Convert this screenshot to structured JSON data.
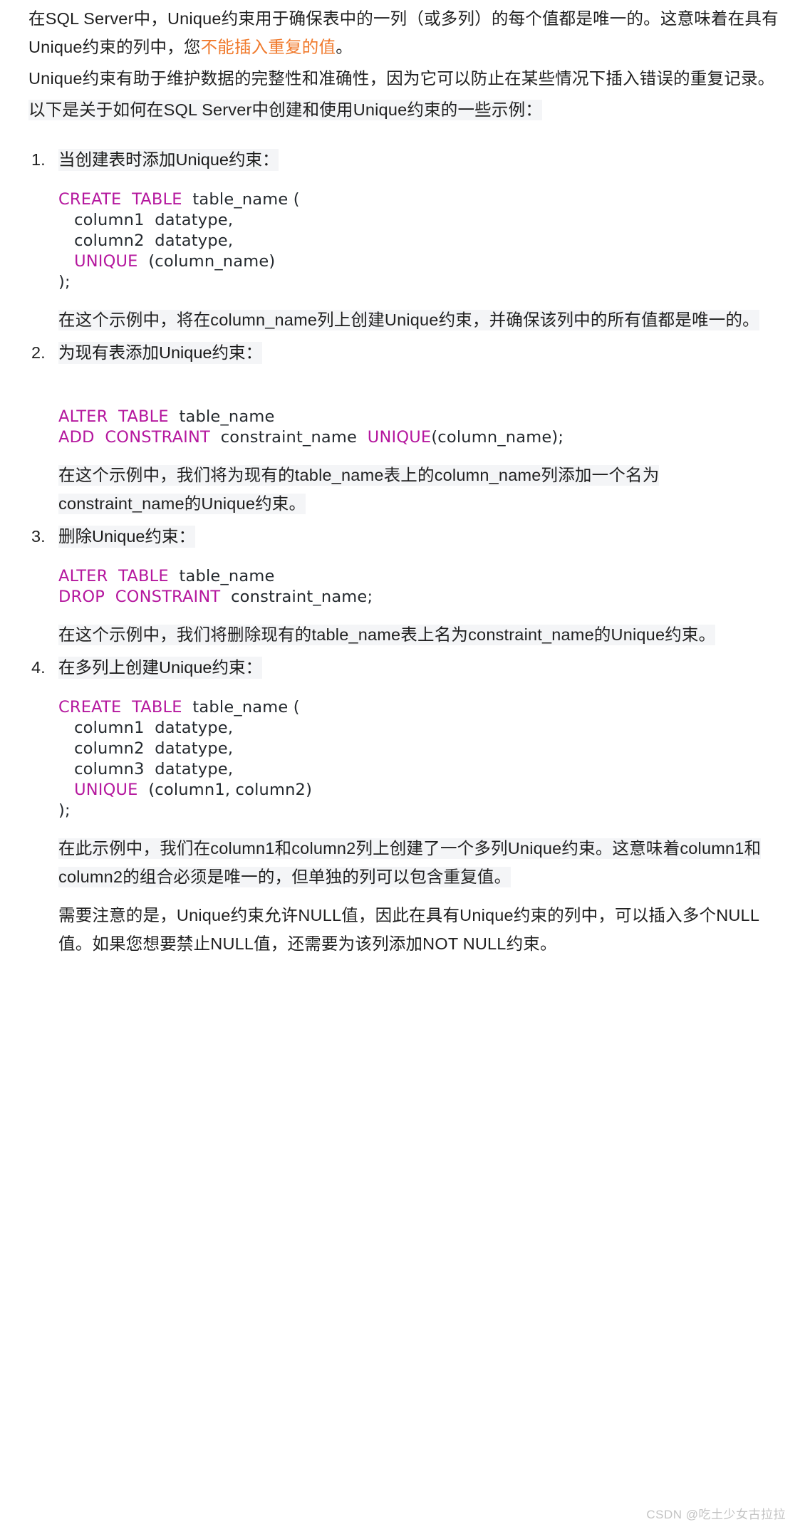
{
  "document": {
    "intro": {
      "p1_before": "在SQL Server中，Unique约束用于确保表中的一列（或多列）的每个值都是唯一的。这意味着在具有Unique约束的列中，您",
      "p1_orange": "不能插入重复的值",
      "p1_after": "。",
      "p2": "Unique约束有助于维护数据的完整性和准确性，因为它可以防止在某些情况下插入错误的重复记录。",
      "p3": "以下是关于如何在SQL Server中创建和使用Unique约束的一些示例："
    },
    "steps": [
      {
        "title": "当创建表时添加Unique约束：",
        "code": [
          {
            "kw": "CREATE",
            "sp": "  ",
            "kw2": "TABLE",
            "rest": "  table_name ("
          },
          {
            "plain": "   column1  datatype,"
          },
          {
            "plain": "   column2  datatype,"
          },
          {
            "kw": "   UNIQUE",
            "rest": "  (column_name)"
          },
          {
            "plain": ");"
          }
        ],
        "code_text_1": "CREATE  TABLE  table_name (\n   column1  datatype,\n   column2  datatype,\n   UNIQUE  (column_name)\n);",
        "explain": "在这个示例中，将在column_name列上创建Unique约束，并确保该列中的所有值都是唯一的。"
      },
      {
        "title": "为现有表添加Unique约束：",
        "explain": "在这个示例中，我们将为现有的table_name表上的column_name列添加一个名为constraint_name的Unique约束。"
      },
      {
        "title": "删除Unique约束：",
        "explain": "在这个示例中，我们将删除现有的table_name表上名为constraint_name的Unique约束。"
      },
      {
        "title": "在多列上创建Unique约束：",
        "explain": "在此示例中，我们在column1和column2列上创建了一个多列Unique约束。这意味着column1和column2的组合必须是唯一的，但单独的列可以包含重复值。"
      }
    ],
    "code_blocks": {
      "create_table": {
        "l1_kw1": "CREATE",
        "l1_kw2": "TABLE",
        "l1_rest": "table_name (",
        "l2": "column1  datatype,",
        "l3": "column2  datatype,",
        "l4_kw": "UNIQUE",
        "l4_rest": "(column_name)",
        "l5": ");"
      },
      "alter_add": {
        "l1_kw1": "ALTER",
        "l1_kw2": "TABLE",
        "l1_rest": "table_name",
        "l2_kw1": "ADD",
        "l2_kw2": "CONSTRAINT",
        "l2_mid": "constraint_name",
        "l2_kw3": "UNIQUE",
        "l2_rest": "(column_name);"
      },
      "alter_drop": {
        "l1_kw1": "ALTER",
        "l1_kw2": "TABLE",
        "l1_rest": "table_name",
        "l2_kw1": "DROP",
        "l2_kw2": "CONSTRAINT",
        "l2_rest": "constraint_name;"
      },
      "create_multi": {
        "l1_kw1": "CREATE",
        "l1_kw2": "TABLE",
        "l1_rest": "table_name (",
        "l2": "column1  datatype,",
        "l3": "column2  datatype,",
        "l4": "column3  datatype,",
        "l5_kw": "UNIQUE",
        "l5_rest": "(column1, column2)",
        "l6": ");"
      }
    },
    "closing": "需要注意的是，Unique约束允许NULL值，因此在具有Unique约束的列中，可以插入多个NULL值。如果您想要禁止NULL值，还需要为该列添加NOT NULL约束。",
    "watermark": "CSDN @吃土少女古拉拉"
  },
  "colors": {
    "keyword": "#b5179e",
    "highlight_bg": "#f4f5f7",
    "emphasis": "#f0792b",
    "text": "#1f1f1f",
    "watermark": "#c3c3c3"
  }
}
